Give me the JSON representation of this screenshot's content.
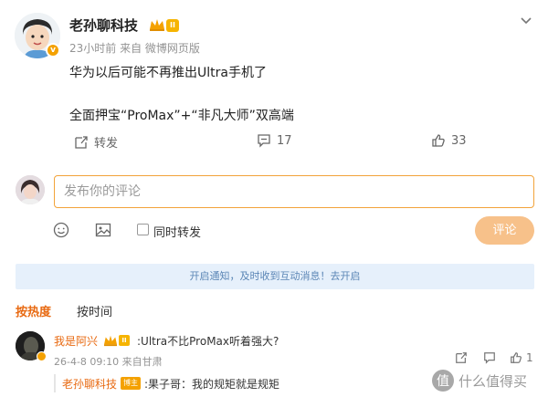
{
  "post": {
    "author": "老孙聊科技",
    "level_badge": "II",
    "meta": "23小时前 来自 微博网页版",
    "line1": "华为以后可能不再推出Ultra手机了",
    "line2": "全面押宝“ProMax”+“非凡大师”双高端",
    "repost_label": "转发",
    "comment_count": "17",
    "like_count": "33"
  },
  "composer": {
    "placeholder": "发布你的评论",
    "sync_repost_label": "同时转发",
    "submit_label": "评论"
  },
  "notice": {
    "text": "开启通知，及时收到互动消息！去开启"
  },
  "tabs": {
    "hot": "按热度",
    "time": "按时间"
  },
  "comment": {
    "user": "我是阿兴",
    "level_badge": "II",
    "text": ":Ultra不比ProMax听着强大?",
    "meta": "26-4-8 09:10 来自甘肃",
    "like_count": "1"
  },
  "reply": {
    "user": "老孙聊科技",
    "tag": "博主",
    "text": ":果子哥：我的规矩就是规矩"
  },
  "watermark": {
    "text": "什么值得买"
  },
  "colors": {
    "accent": "#e86a12",
    "input_border": "#f2a33a",
    "button_disabled": "#f7c18a",
    "notice_bg": "#e6f0fb",
    "notice_text": "#5b86b6",
    "badge": "#f4a100"
  },
  "icons": [
    "chevron-down-icon",
    "repost-icon",
    "comment-icon",
    "like-icon",
    "emoji-icon",
    "image-icon",
    "share-icon",
    "reply-icon",
    "crown-icon",
    "verified-icon"
  ]
}
